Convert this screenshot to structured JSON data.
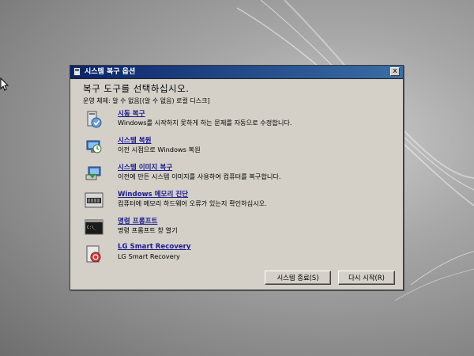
{
  "dialog": {
    "title": "시스템 복구 옵션",
    "close_label": "x",
    "heading": "복구 도구를 선택하십시오.",
    "os_info": "운영 체제: 알 수 없음[(알 수 없음) 로컬 디스크]"
  },
  "tools": [
    {
      "label": "시동 복구",
      "description": "Windows를 시작하지 못하게 하는 문제를 자동으로 수정합니다.",
      "icon": "startup-repair-icon"
    },
    {
      "label": "시스템 복원",
      "description": "이전 시점으로 Windows 복원",
      "icon": "system-restore-icon"
    },
    {
      "label": "시스템 이미지 복구",
      "description": "이전에 만든 시스템 이미지를 사용하여 컴퓨터를 복구합니다.",
      "icon": "system-image-recovery-icon"
    },
    {
      "label": "Windows 메모리 진단",
      "description": "컴퓨터에 메모리 하드웨어 오류가 있는지 확인하십시오.",
      "icon": "memory-diagnostic-icon"
    },
    {
      "label": "명령 프롬프트",
      "description": "명령 프롬프트 창 열기",
      "icon": "command-prompt-icon"
    },
    {
      "label": "LG Smart Recovery",
      "description": "LG Smart Recovery",
      "icon": "lg-smart-recovery-icon"
    }
  ],
  "buttons": {
    "shutdown": "시스템 종료(S)",
    "restart": "다시 시작(R)"
  },
  "colors": {
    "title_bar": "#0a246a",
    "dialog_bg": "#d4d0c8",
    "link": "#1b1b8f"
  }
}
